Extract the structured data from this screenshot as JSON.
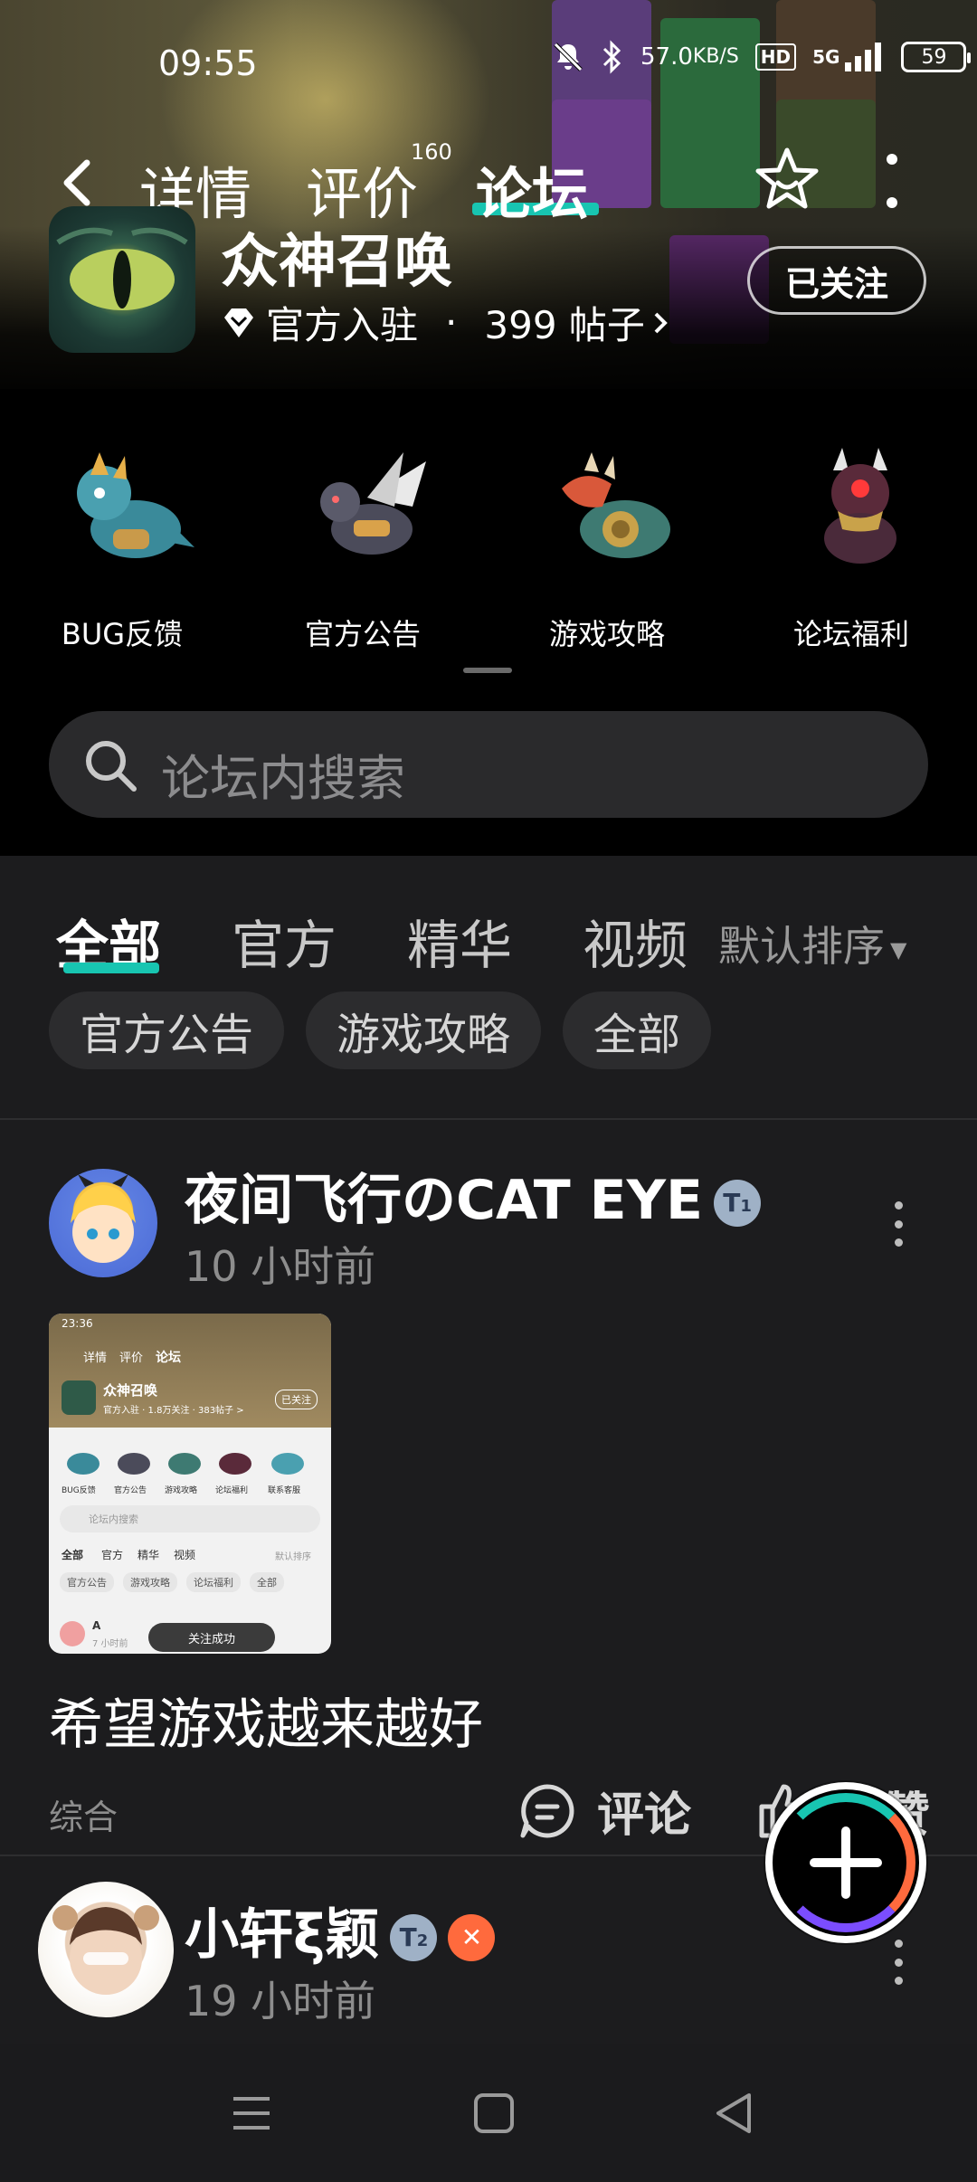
{
  "status_bar": {
    "time": "09:55",
    "net_speed": "57.0",
    "net_unit": "KB/S",
    "hd_label": "HD",
    "network_label": "5G",
    "battery": "59",
    "icons": [
      "mute-icon",
      "bluetooth-icon",
      "signal-icon",
      "battery-icon"
    ]
  },
  "nav": {
    "tabs": [
      {
        "label": "详情"
      },
      {
        "label": "评价",
        "badge": "160"
      },
      {
        "label": "论坛"
      }
    ],
    "active_tab": "论坛",
    "accent": "#18c5b1"
  },
  "game": {
    "title": "众神召唤",
    "official": "官方入驻",
    "separator": "·",
    "posts": "399 帖子",
    "follow_label": "已关注"
  },
  "categories": [
    {
      "label": "BUG反馈",
      "icon": "teal-dragon-icon"
    },
    {
      "label": "官方公告",
      "icon": "winged-dragon-icon"
    },
    {
      "label": "游戏攻略",
      "icon": "red-dragon-icon"
    },
    {
      "label": "论坛福利",
      "icon": "dark-dragon-icon"
    }
  ],
  "search": {
    "placeholder": "论坛内搜索"
  },
  "feed_tabs": {
    "tabs": [
      "全部",
      "官方",
      "精华",
      "视频"
    ],
    "active": "全部",
    "sort_label": "默认排序"
  },
  "chips": [
    "官方公告",
    "游戏攻略",
    "全部"
  ],
  "posts": [
    {
      "author": "夜间飞行のCAT EYE",
      "badge": "1",
      "time": "10 小时前",
      "body": "希望游戏越来越好",
      "tag": "综合",
      "comment_label": "评论",
      "like_label": "点赞",
      "thumb": {
        "time": "23:36",
        "tabs": [
          "详情",
          "评价",
          "论坛"
        ],
        "title": "众神召唤",
        "meta": "官方入驻 · 1.8万关注 · 383帖子 >",
        "follow": "已关注",
        "cats": [
          "BUG反馈",
          "官方公告",
          "游戏攻略",
          "论坛福利",
          "联系客服"
        ],
        "search": "论坛内搜索",
        "ftabs": [
          "全部",
          "官方",
          "精华",
          "视频"
        ],
        "sort": "默认排序",
        "chips": [
          "官方公告",
          "游戏攻略",
          "论坛福利",
          "全部"
        ],
        "author_initial": "A",
        "time_ago": "7 小时前",
        "toast": "关注成功"
      }
    },
    {
      "author": "小轩ξ颖",
      "badge": "2",
      "time": "19 小时前"
    }
  ],
  "fab": {
    "icon": "plus-icon"
  },
  "system_nav": [
    "menu-icon",
    "home-icon",
    "back-icon"
  ]
}
